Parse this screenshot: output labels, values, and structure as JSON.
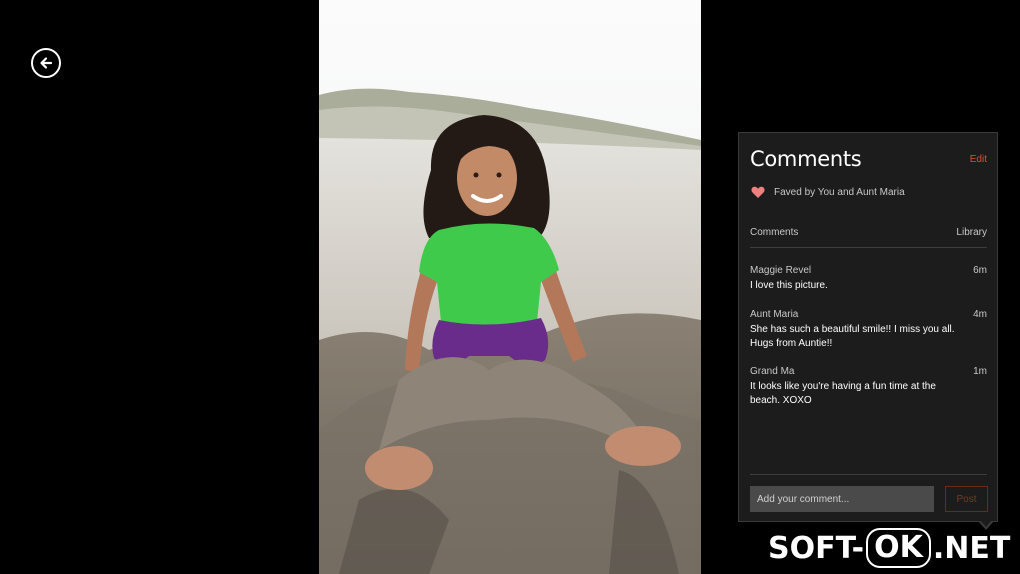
{
  "nav": {
    "back_icon": "back-arrow-icon"
  },
  "photo": {
    "subject": "photo"
  },
  "comments_panel": {
    "title": "Comments",
    "edit_label": "Edit",
    "faved_text": "Faved by You and Aunt Maria",
    "heart_color": "#f08080",
    "tab_comments": "Comments",
    "tab_library": "Library",
    "comments": [
      {
        "author": "Maggie Revel",
        "time": "6m",
        "text": "I love this picture."
      },
      {
        "author": "Aunt Maria",
        "time": "4m",
        "text": "She has such a beautiful smile!!  I miss you all. Hugs from Auntie!!"
      },
      {
        "author": "Grand Ma",
        "time": "1m",
        "text": "It looks like you're having a fun time at the beach. XOXO"
      }
    ],
    "input_placeholder": "Add your comment...",
    "post_label": "Post",
    "accent_color": "#d9542b"
  },
  "watermark": {
    "part1": "SOFT-",
    "part2": "OK",
    "part3": ".NET"
  }
}
